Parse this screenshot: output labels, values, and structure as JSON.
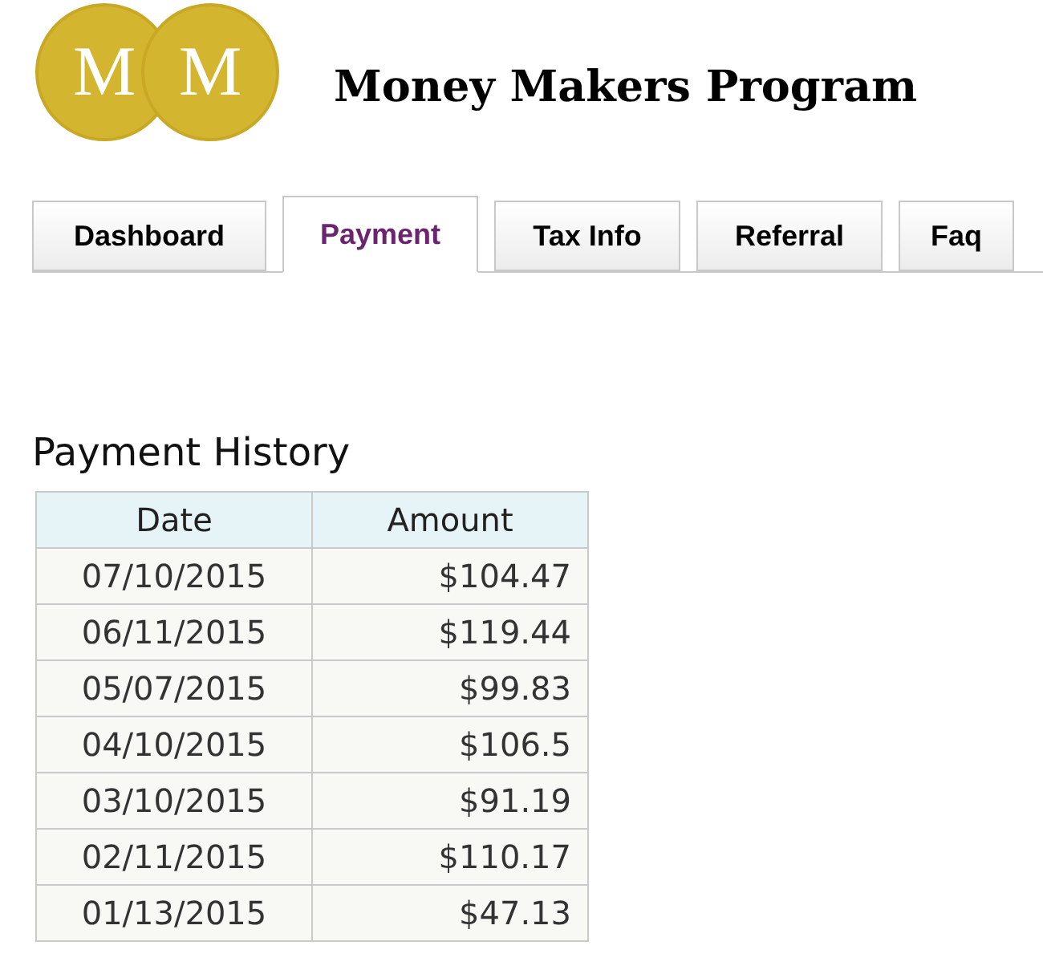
{
  "logo": {
    "letters": [
      "M",
      "M"
    ]
  },
  "title": "Money Makers Program",
  "tabs": [
    {
      "label": "Dashboard",
      "selected": false
    },
    {
      "label": "Payment",
      "selected": true
    },
    {
      "label": "Tax Info",
      "selected": false
    },
    {
      "label": "Referral",
      "selected": false
    },
    {
      "label": "Faq",
      "selected": false
    }
  ],
  "section_title": "Payment History",
  "table": {
    "columns": [
      "Date",
      "Amount"
    ],
    "rows": [
      [
        "07/10/2015",
        "$104.47"
      ],
      [
        "06/11/2015",
        "$119.44"
      ],
      [
        "05/07/2015",
        "$99.83"
      ],
      [
        "04/10/2015",
        "$106.5"
      ],
      [
        "03/10/2015",
        "$91.19"
      ],
      [
        "02/11/2015",
        "$110.17"
      ],
      [
        "01/13/2015",
        "$47.13"
      ]
    ]
  }
}
